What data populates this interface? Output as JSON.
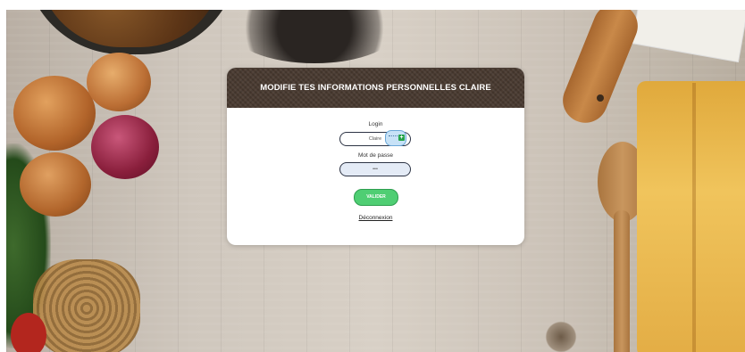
{
  "modal": {
    "title": "MODIFIE TES INFORMATIONS PERSONNELLES CLAIRE",
    "login_label": "Login",
    "login_value": "Claire",
    "password_label": "Mot de passe",
    "password_value": "•••",
    "validate_label": "VALIDER",
    "logout_label": "Déconnexion"
  },
  "colors": {
    "header_bg": "#4a3b31",
    "validate_bg": "#4fce73",
    "input_border": "#2d3445"
  }
}
